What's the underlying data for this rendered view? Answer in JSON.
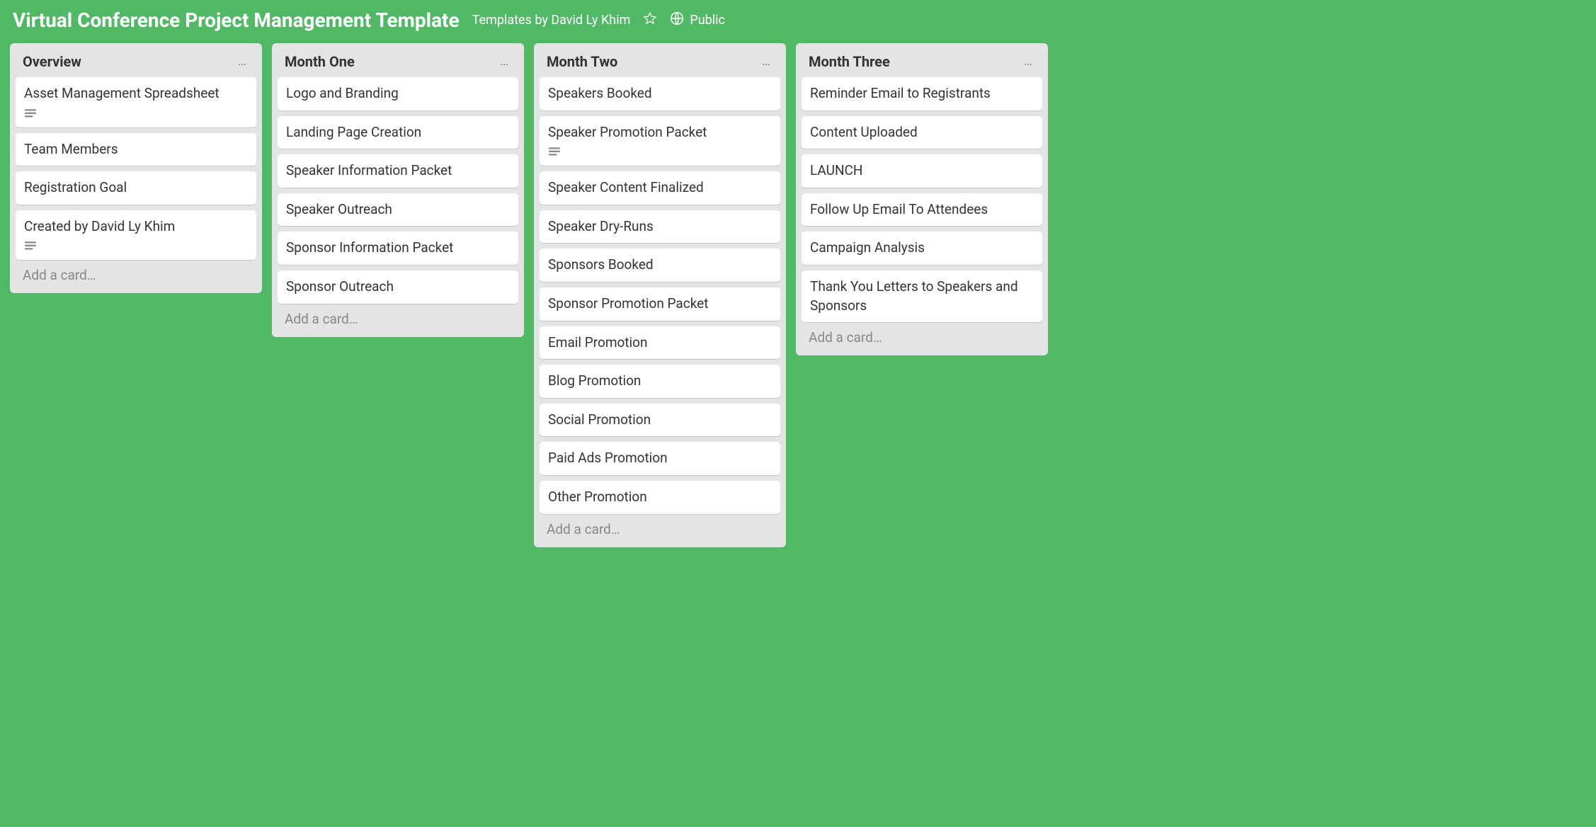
{
  "header": {
    "board_title": "Virtual Conference Project Management Template",
    "templates_by": "Templates by David Ly Khim",
    "public_label": "Public"
  },
  "add_card_label": "Add a card…",
  "lists": [
    {
      "title": "Overview",
      "cards": [
        {
          "title": "Asset Management Spreadsheet",
          "has_description": true
        },
        {
          "title": "Team Members",
          "has_description": false
        },
        {
          "title": "Registration Goal",
          "has_description": false
        },
        {
          "title": "Created by David Ly Khim",
          "has_description": true
        }
      ]
    },
    {
      "title": "Month One",
      "cards": [
        {
          "title": "Logo and Branding",
          "has_description": false
        },
        {
          "title": "Landing Page Creation",
          "has_description": false
        },
        {
          "title": "Speaker Information Packet",
          "has_description": false
        },
        {
          "title": "Speaker Outreach",
          "has_description": false
        },
        {
          "title": "Sponsor Information Packet",
          "has_description": false
        },
        {
          "title": "Sponsor Outreach",
          "has_description": false
        }
      ]
    },
    {
      "title": "Month Two",
      "cards": [
        {
          "title": "Speakers Booked",
          "has_description": false
        },
        {
          "title": "Speaker Promotion Packet",
          "has_description": true
        },
        {
          "title": "Speaker Content Finalized",
          "has_description": false
        },
        {
          "title": "Speaker Dry-Runs",
          "has_description": false
        },
        {
          "title": "Sponsors Booked",
          "has_description": false
        },
        {
          "title": "Sponsor Promotion Packet",
          "has_description": false
        },
        {
          "title": "Email Promotion",
          "has_description": false
        },
        {
          "title": "Blog Promotion",
          "has_description": false
        },
        {
          "title": "Social Promotion",
          "has_description": false
        },
        {
          "title": "Paid Ads Promotion",
          "has_description": false
        },
        {
          "title": "Other Promotion",
          "has_description": false
        }
      ]
    },
    {
      "title": "Month Three",
      "cards": [
        {
          "title": "Reminder Email to Registrants",
          "has_description": false
        },
        {
          "title": "Content Uploaded",
          "has_description": false
        },
        {
          "title": "LAUNCH",
          "has_description": false
        },
        {
          "title": "Follow Up Email To Attendees",
          "has_description": false
        },
        {
          "title": "Campaign Analysis",
          "has_description": false
        },
        {
          "title": "Thank You Letters to Speakers and Sponsors",
          "has_description": false
        }
      ]
    }
  ]
}
